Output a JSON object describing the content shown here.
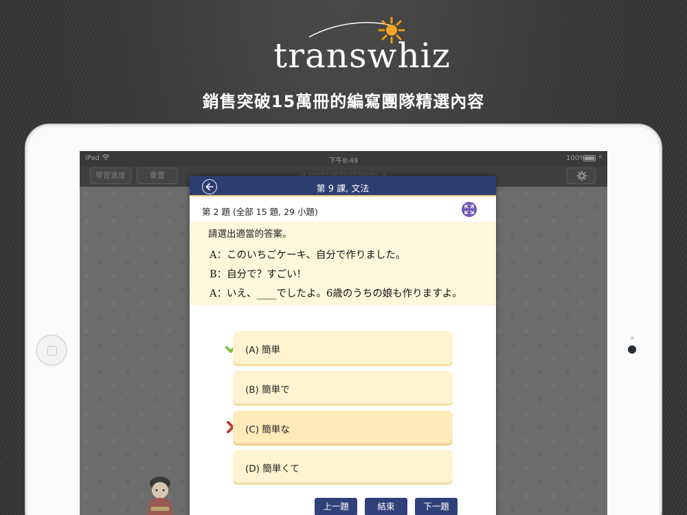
{
  "brand": {
    "name": "transwhiz",
    "tagline": "銷售突破15萬冊的編寫團隊精選內容",
    "accent_color": "#f39c12",
    "icons": [
      "sun-icon"
    ]
  },
  "status_bar": {
    "device": "iPad",
    "time": "下午8:49",
    "battery": "100%",
    "icons": [
      "wifi-icon",
      "battery-icon",
      "charge-icon"
    ]
  },
  "app_toolbar": {
    "progress_label": "學習進度",
    "reset_label": "重置",
    "title": "JLPT日語初級題庫 4",
    "icons": [
      "gear-icon"
    ]
  },
  "quiz": {
    "header_title": "第 9 課, 文法",
    "question_meta": "第 2 題 (全部 15 題, 29 小題)",
    "instruction": "請選出適當的答案。",
    "dialogue": [
      "A：このいちごケーキ、自分で作りました。",
      "B：自分で？すごい！",
      "A：いえ、____でしたよ。6歳のうちの娘も作りますよ。"
    ],
    "options": [
      {
        "label": "(A) 簡単",
        "state": "correct"
      },
      {
        "label": "(B) 簡単で",
        "state": "none"
      },
      {
        "label": "(C) 簡単な",
        "state": "selected-wrong"
      },
      {
        "label": "(D) 簡単くて",
        "state": "none"
      }
    ],
    "nav": {
      "prev_label": "上一題",
      "end_label": "結束",
      "next_label": "下一題"
    },
    "icons": [
      "back-arrow-icon",
      "fullscreen-icon",
      "check-icon",
      "cross-icon"
    ],
    "colors": {
      "header": "#2c3d70",
      "question_bg": "#fff7dc",
      "option_bg": "#fff4cf",
      "correct": "#7cc242",
      "wrong": "#c0392b",
      "fullscreen_button": "#6f55b8"
    }
  }
}
